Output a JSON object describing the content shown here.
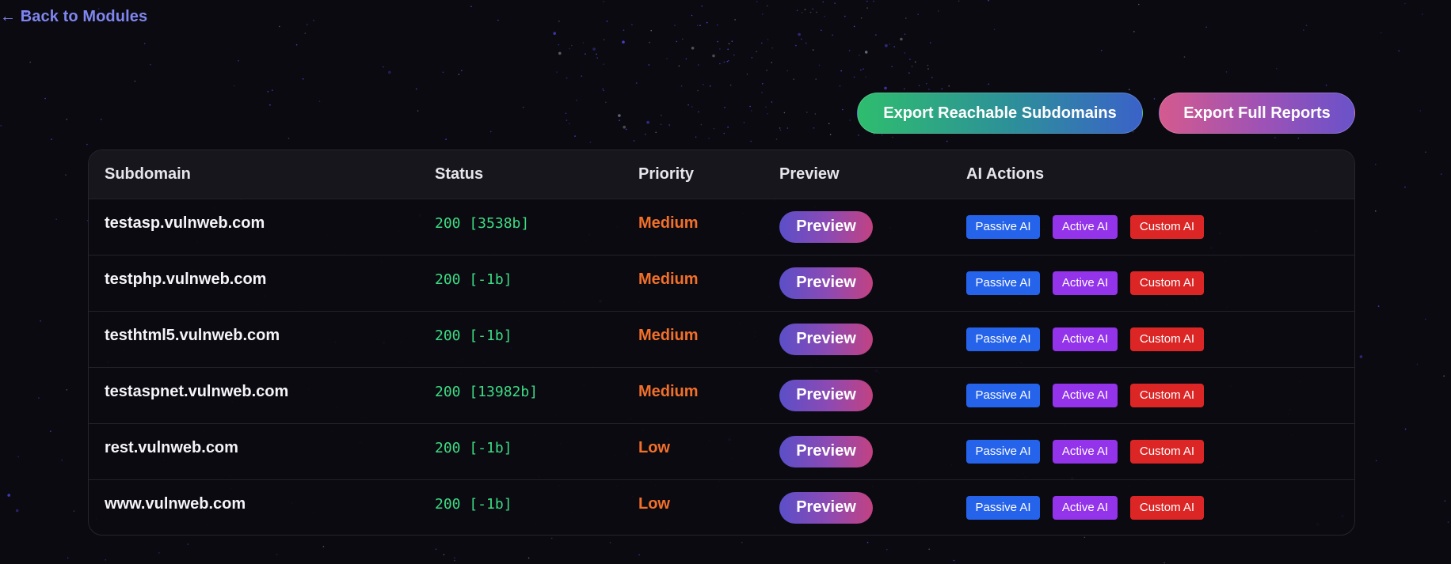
{
  "nav": {
    "back_label": "← Back to Modules"
  },
  "toolbar": {
    "export_reachable_label": "Export Reachable Subdomains",
    "export_full_label": "Export Full Reports"
  },
  "table": {
    "headers": {
      "subdomain": "Subdomain",
      "status": "Status",
      "priority": "Priority",
      "preview": "Preview",
      "ai_actions": "AI Actions"
    },
    "rows": [
      {
        "subdomain": "testasp.vulnweb.com",
        "status": "200 [3538b]",
        "priority": "Medium"
      },
      {
        "subdomain": "testphp.vulnweb.com",
        "status": "200 [-1b]",
        "priority": "Medium"
      },
      {
        "subdomain": "testhtml5.vulnweb.com",
        "status": "200 [-1b]",
        "priority": "Medium"
      },
      {
        "subdomain": "testaspnet.vulnweb.com",
        "status": "200 [13982b]",
        "priority": "Medium"
      },
      {
        "subdomain": "rest.vulnweb.com",
        "status": "200 [-1b]",
        "priority": "Low"
      },
      {
        "subdomain": "www.vulnweb.com",
        "status": "200 [-1b]",
        "priority": "Low"
      }
    ],
    "preview_label": "Preview",
    "ai_labels": {
      "passive": "Passive AI",
      "active": "Active AI",
      "custom": "Custom AI"
    }
  },
  "colors": {
    "status_ok": "#3ddc84",
    "priority": "#f2702a",
    "passive_ai": "#2563eb",
    "active_ai": "#9333ea",
    "custom_ai": "#dc2626",
    "link": "#7f86f0"
  }
}
